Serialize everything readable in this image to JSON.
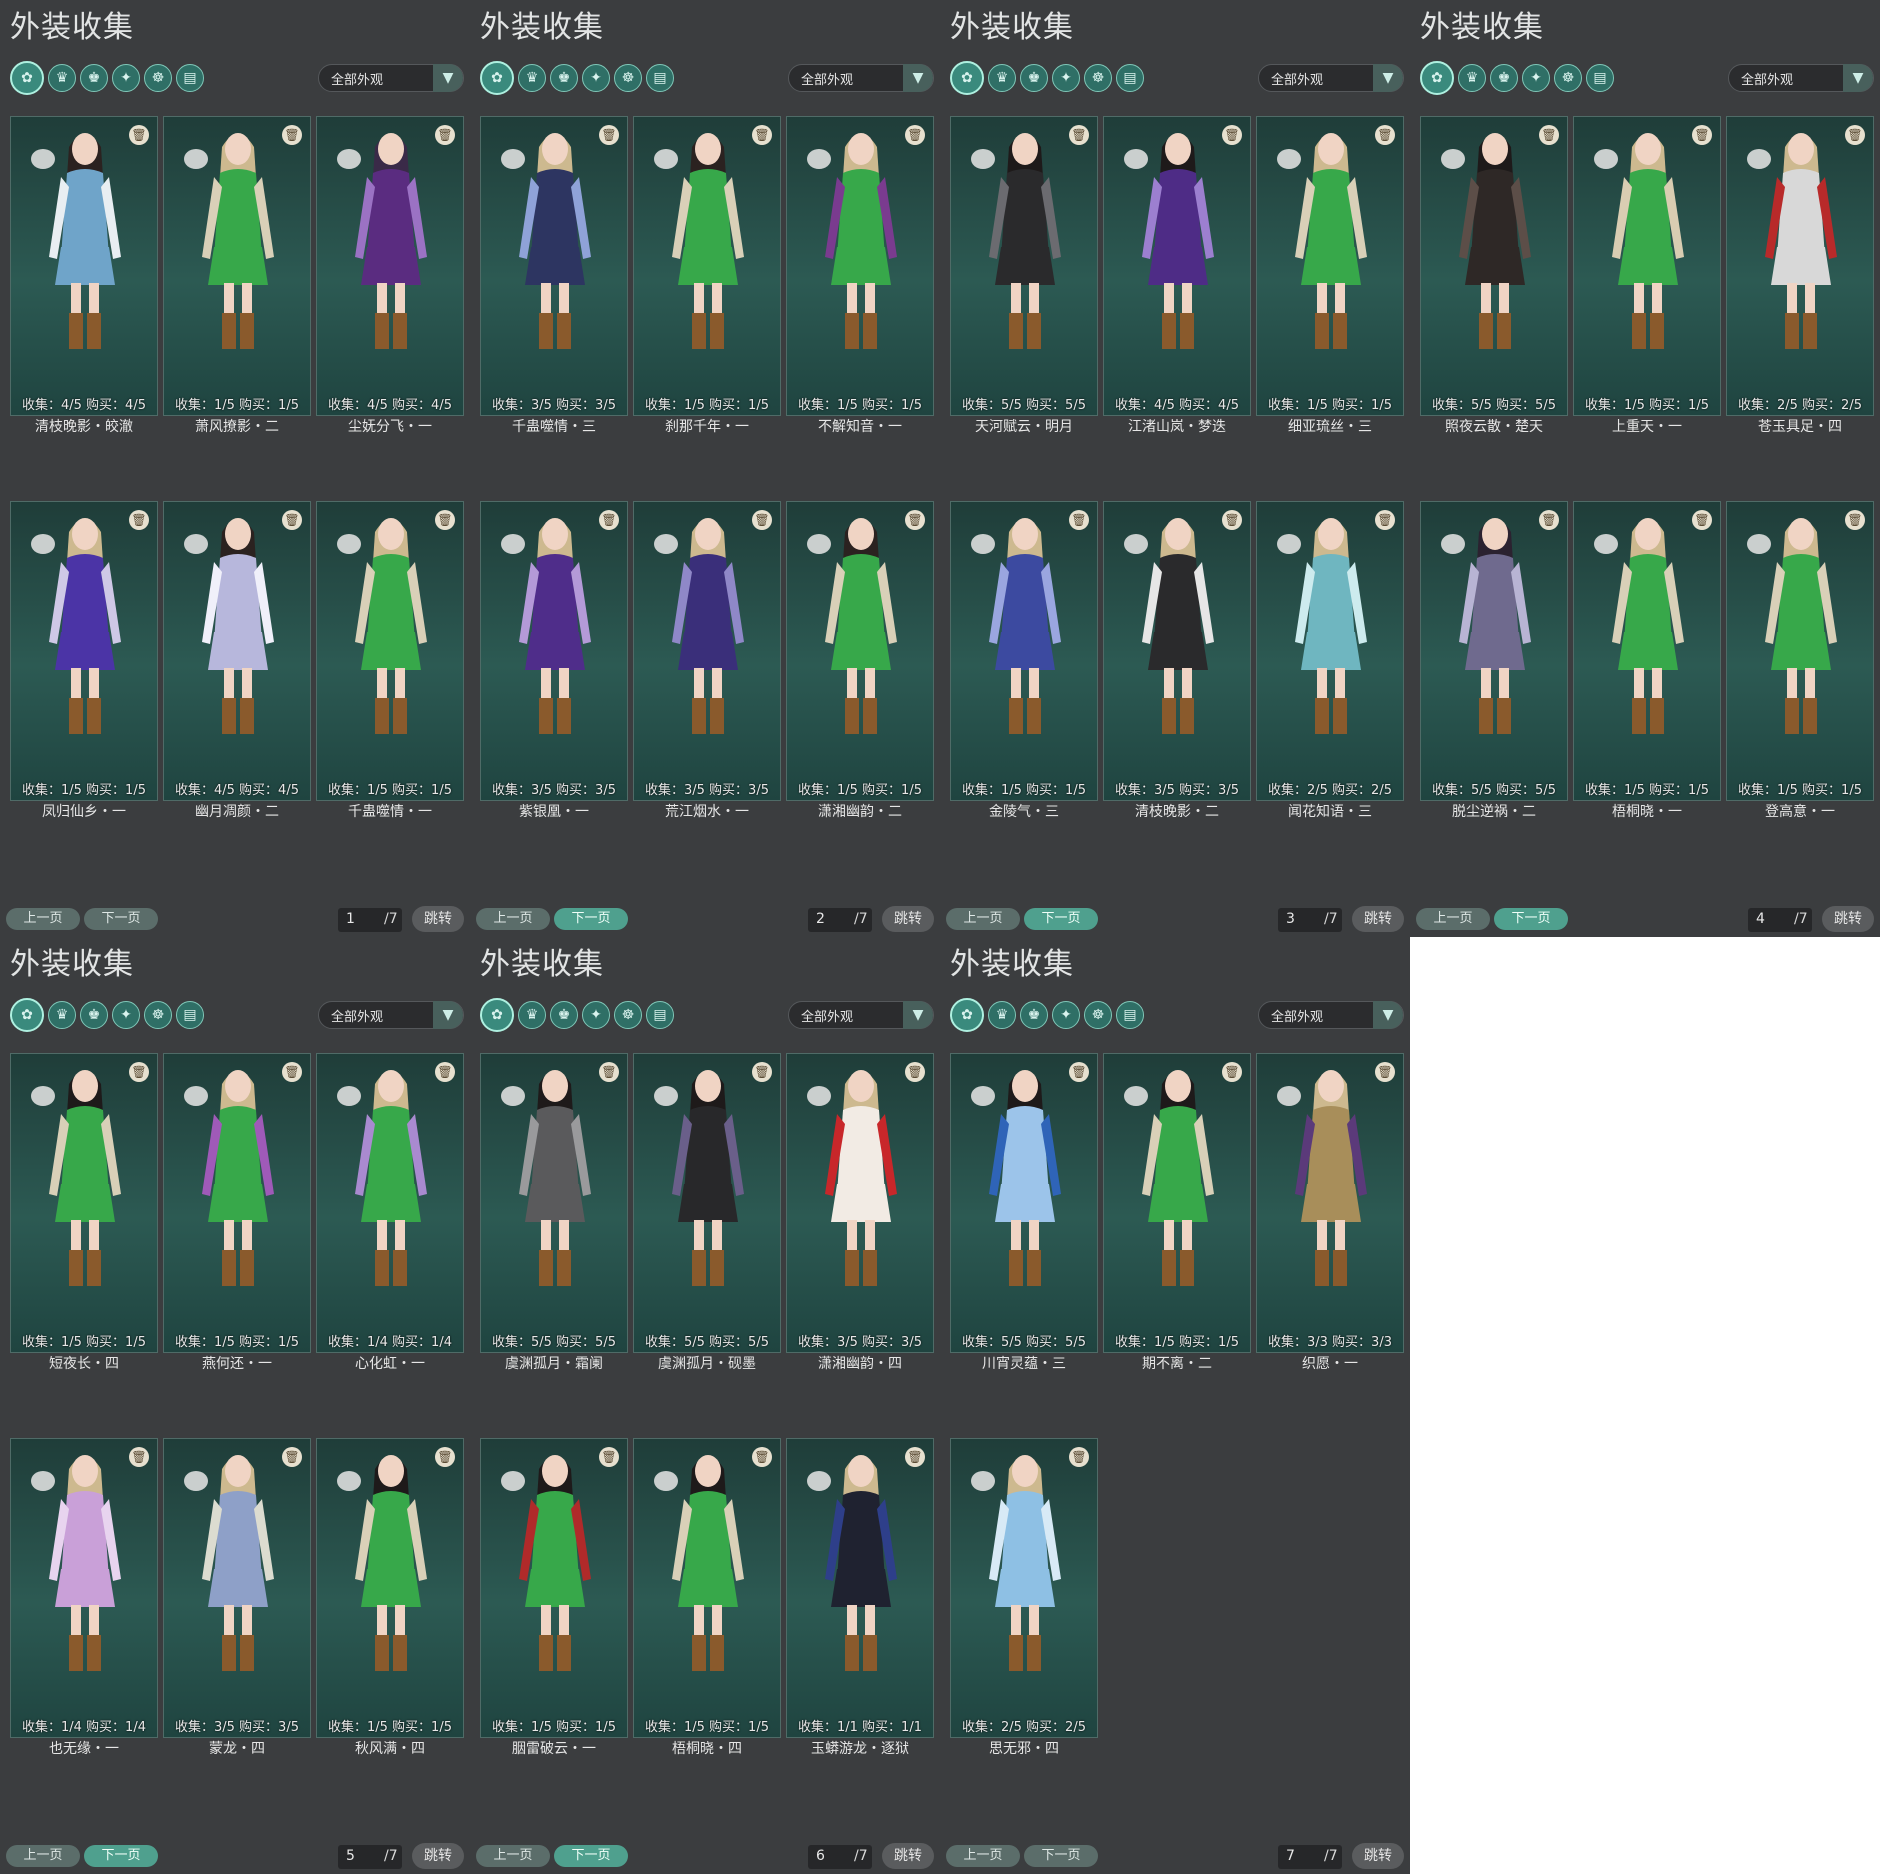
{
  "common": {
    "title": "外装收集",
    "filter_label": "全部外观",
    "filter_icons": [
      "costume-all-icon",
      "costume-hair-icon",
      "costume-top-icon",
      "costume-accessory-icon",
      "costume-mask-icon",
      "costume-misc-icon"
    ],
    "prev_label": "上一页",
    "next_label": "下一页",
    "jump_label": "跳转",
    "page_total": "/7"
  },
  "panels": [
    {
      "page": "1",
      "next_highlight": false,
      "cards": [
        {
          "stats": "收集：4/5   购买：4/5",
          "name": "清枝晚影・皎澈",
          "outfit": "#6fa4c9",
          "accent": "#e9eef2",
          "hair": "#2b2220"
        },
        {
          "stats": "收集：1/5   购买：1/5",
          "name": "萧风撩影・二",
          "outfit": "#37a84a",
          "accent": "#d9d0b8",
          "hair": "#cdb98f"
        },
        {
          "stats": "收集：4/5   购买：4/5",
          "name": "尘妩分飞・一",
          "outfit": "#5a2c80",
          "accent": "#9b72c4",
          "hair": "#3a2a48"
        },
        {
          "stats": "收集：1/5   购买：1/5",
          "name": "凤归仙乡・一",
          "outfit": "#4b34a6",
          "accent": "#cfc8e6",
          "hair": "#cdb98f"
        },
        {
          "stats": "收集：4/5   购买：4/5",
          "name": "幽月凋颜・二",
          "outfit": "#b7b7dc",
          "accent": "#f0f0fa",
          "hair": "#2b2220"
        },
        {
          "stats": "收集：1/5   购买：1/5",
          "name": "千蛊噬情・一",
          "outfit": "#37a84a",
          "accent": "#d9d0b8",
          "hair": "#cdb98f"
        }
      ]
    },
    {
      "page": "2",
      "next_highlight": true,
      "cards": [
        {
          "stats": "收集：3/5   购买：3/5",
          "name": "千蛊噬情・三",
          "outfit": "#2d3561",
          "accent": "#8fa2d8",
          "hair": "#cdb98f"
        },
        {
          "stats": "收集：1/5   购买：1/5",
          "name": "刹那千年・一",
          "outfit": "#37a84a",
          "accent": "#d9d0b8",
          "hair": "#2b2220"
        },
        {
          "stats": "收集：1/5   购买：1/5",
          "name": "不解知音・一",
          "outfit": "#37a84a",
          "accent": "#7a3b8f",
          "hair": "#cdb98f"
        },
        {
          "stats": "收集：3/5   购买：3/5",
          "name": "紫银凰・一",
          "outfit": "#4f2d8a",
          "accent": "#b49ad8",
          "hair": "#cdb98f"
        },
        {
          "stats": "收集：3/5   购买：3/5",
          "name": "荒江烟水・一",
          "outfit": "#3a2f7a",
          "accent": "#8f88c8",
          "hair": "#cdb98f"
        },
        {
          "stats": "收集：1/5   购买：1/5",
          "name": "潇湘幽韵・二",
          "outfit": "#37a84a",
          "accent": "#d9d0b8",
          "hair": "#2b2220"
        }
      ]
    },
    {
      "page": "3",
      "next_highlight": true,
      "cards": [
        {
          "stats": "收集：5/5   购买：5/5",
          "name": "天河赋云・明月",
          "outfit": "#2a2a2c",
          "accent": "#6b6b70",
          "hair": "#1e1a1a"
        },
        {
          "stats": "收集：4/5   购买：4/5",
          "name": "江渚山岚・梦迭",
          "outfit": "#4e2c86",
          "accent": "#9c7fd0",
          "hair": "#1e1a1a"
        },
        {
          "stats": "收集：1/5   购买：1/5",
          "name": "细亚琉丝・三",
          "outfit": "#37a84a",
          "accent": "#d9d0b8",
          "hair": "#cdb98f"
        },
        {
          "stats": "收集：1/5   购买：1/5",
          "name": "金陵气・三",
          "outfit": "#3c4aa0",
          "accent": "#9aa6e0",
          "hair": "#cdb98f"
        },
        {
          "stats": "收集：3/5   购买：3/5",
          "name": "清枝晚影・二",
          "outfit": "#2a2a2c",
          "accent": "#e6e6e6",
          "hair": "#cdb98f"
        },
        {
          "stats": "收集：2/5   购买：2/5",
          "name": "闻花知语・三",
          "outfit": "#6fb6c0",
          "accent": "#cdebee",
          "hair": "#cdb98f"
        }
      ]
    },
    {
      "page": "4",
      "next_highlight": true,
      "cards": [
        {
          "stats": "收集：5/5   购买：5/5",
          "name": "照夜云散・楚天",
          "outfit": "#2e2826",
          "accent": "#5c4e48",
          "hair": "#1e1a1a"
        },
        {
          "stats": "收集：1/5   购买：1/5",
          "name": "上重天・一",
          "outfit": "#37a84a",
          "accent": "#d9cdb2",
          "hair": "#cdb98f"
        },
        {
          "stats": "收集：2/5   购买：2/5",
          "name": "苍玉具足・四",
          "outfit": "#d8d8d8",
          "accent": "#b82a2a",
          "hair": "#cdb98f"
        },
        {
          "stats": "收集：5/5   购买：5/5",
          "name": "脱尘逆祸・二",
          "outfit": "#6f6a8e",
          "accent": "#b8b4d4",
          "hair": "#2b2230"
        },
        {
          "stats": "收集：1/5   购买：1/5",
          "name": "梧桐晓・一",
          "outfit": "#37a84a",
          "accent": "#d9d0b8",
          "hair": "#cdb98f"
        },
        {
          "stats": "收集：1/5   购买：1/5",
          "name": "登高意・一",
          "outfit": "#37a84a",
          "accent": "#d9d0b8",
          "hair": "#cdb98f"
        }
      ]
    },
    {
      "page": "5",
      "next_highlight": true,
      "cards": [
        {
          "stats": "收集：1/5   购买：1/5",
          "name": "短夜长・四",
          "outfit": "#37a84a",
          "accent": "#d9d0b8",
          "hair": "#1e1a1a"
        },
        {
          "stats": "收集：1/5   购买：1/5",
          "name": "燕何还・一",
          "outfit": "#37a84a",
          "accent": "#9f5ab8",
          "hair": "#cdb98f"
        },
        {
          "stats": "收集：1/4   购买：1/4",
          "name": "心化虹・一",
          "outfit": "#37a84a",
          "accent": "#a98ad0",
          "hair": "#cdb98f"
        },
        {
          "stats": "收集：1/4   购买：1/4",
          "name": "也无缘・一",
          "outfit": "#c9a0d8",
          "accent": "#e8d4ef",
          "hair": "#cdb98f"
        },
        {
          "stats": "收集：3/5   购买：3/5",
          "name": "蒙龙・四",
          "outfit": "#8ea0c8",
          "accent": "#dcdcd0",
          "hair": "#cdb98f"
        },
        {
          "stats": "收集：1/5   购买：1/5",
          "name": "秋风满・四",
          "outfit": "#37a84a",
          "accent": "#d9d0b8",
          "hair": "#1e1a1a"
        }
      ]
    },
    {
      "page": "6",
      "next_highlight": true,
      "cards": [
        {
          "stats": "收集：5/5   购买：5/5",
          "name": "虞渊孤月・霜阑",
          "outfit": "#5a5a5c",
          "accent": "#9a9a9c",
          "hair": "#1e1a1a"
        },
        {
          "stats": "收集：5/5   购买：5/5",
          "name": "虞渊孤月・砚墨",
          "outfit": "#28282a",
          "accent": "#6a5f8a",
          "hair": "#1e1a1a"
        },
        {
          "stats": "收集：3/5   购买：3/5",
          "name": "潇湘幽韵・四",
          "outfit": "#f2ebe4",
          "accent": "#c8272a",
          "hair": "#cdb98f"
        },
        {
          "stats": "收集：1/5   购买：1/5",
          "name": "胭雷破云・一",
          "outfit": "#37a84a",
          "accent": "#b02a2a",
          "hair": "#1e1a1a"
        },
        {
          "stats": "收集：1/5   购买：1/5",
          "name": "梧桐晓・四",
          "outfit": "#37a84a",
          "accent": "#d9d0b8",
          "hair": "#1e1a1a"
        },
        {
          "stats": "收集：1/1   购买：1/1",
          "name": "玉蟒游龙・逐狱",
          "outfit": "#1f2230",
          "accent": "#2e3f8a",
          "hair": "#cdb98f"
        }
      ]
    },
    {
      "page": "7",
      "next_highlight": false,
      "cards": [
        {
          "stats": "收集：5/5   购买：5/5",
          "name": "川宵灵蕴・三",
          "outfit": "#9cc4ea",
          "accent": "#2f64b8",
          "hair": "#1e1a1a"
        },
        {
          "stats": "收集：1/5   购买：1/5",
          "name": "期不离・二",
          "outfit": "#37a84a",
          "accent": "#d9d0b8",
          "hair": "#1e1a1a"
        },
        {
          "stats": "收集：3/3   购买：3/3",
          "name": "织愿・一",
          "outfit": "#a88e5a",
          "accent": "#5b3a7a",
          "hair": "#cdb98f"
        },
        {
          "stats": "收集：2/5   购买：2/5",
          "name": "思无邪・四",
          "outfit": "#8ec0e4",
          "accent": "#d8eaf6",
          "hair": "#cdb98f"
        }
      ]
    }
  ]
}
